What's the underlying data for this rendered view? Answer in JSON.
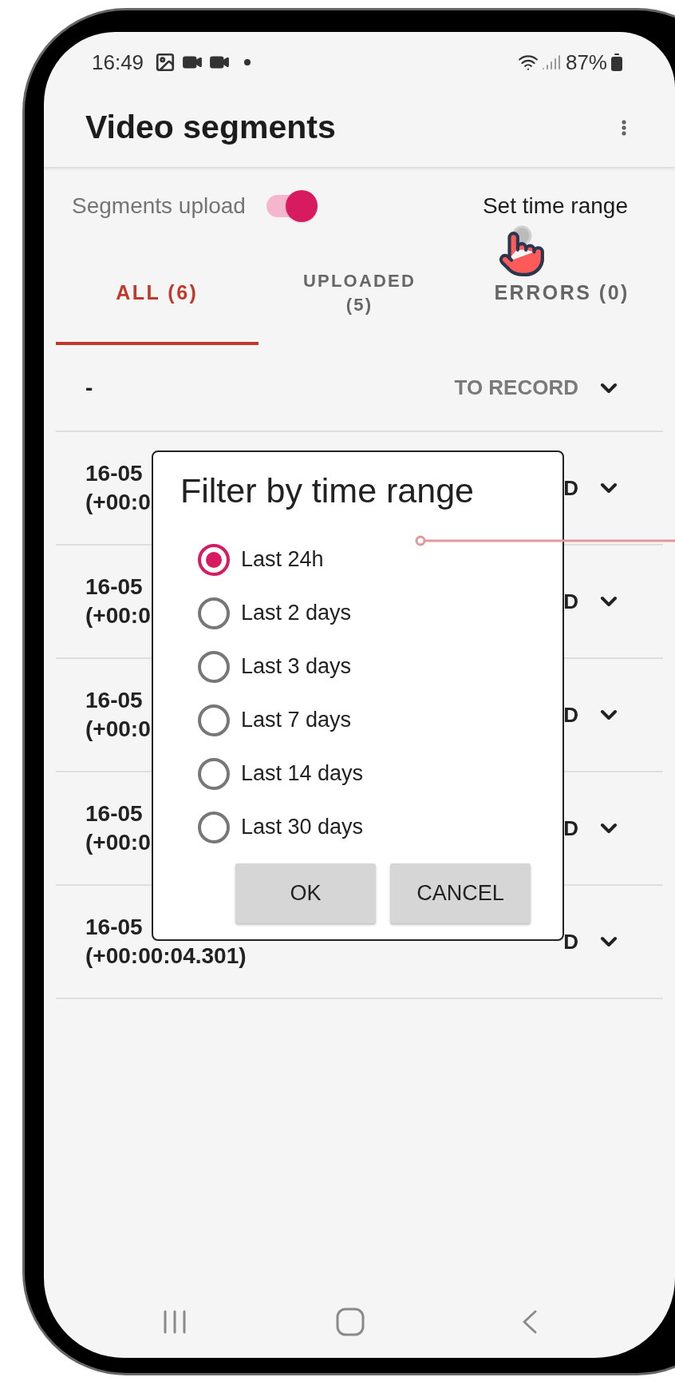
{
  "status_bar": {
    "time": "16:49",
    "battery": "87%"
  },
  "app_bar": {
    "title": "Video segments"
  },
  "controls": {
    "upload_label": "Segments upload",
    "upload_on": true,
    "time_range_link": "Set time range"
  },
  "tabs": [
    {
      "lines": [
        "ALL (6)"
      ],
      "selected": true
    },
    {
      "lines": [
        "UPLOADED",
        "(5)"
      ],
      "selected": false
    },
    {
      "lines": [
        "ERRORS (0)"
      ],
      "selected": false
    }
  ],
  "rows": [
    {
      "lines": [
        "-"
      ],
      "status": "TO RECORD",
      "kind": "pending"
    },
    {
      "lines": [
        "16-05",
        "(+00:0"
      ],
      "status": "D",
      "kind": "uploaded"
    },
    {
      "lines": [
        "16-05",
        "(+00:0"
      ],
      "status": "D",
      "kind": "uploaded"
    },
    {
      "lines": [
        "16-05",
        "(+00:0"
      ],
      "status": "D",
      "kind": "uploaded"
    },
    {
      "lines": [
        "16-05",
        "(+00:0"
      ],
      "status": "D",
      "kind": "uploaded"
    },
    {
      "lines": [
        "16-05",
        "(+00:00:04.301)"
      ],
      "status": "D",
      "kind": "uploaded"
    }
  ],
  "dialog": {
    "title": "Filter by time range",
    "options": [
      {
        "label": "Last 24h",
        "selected": true
      },
      {
        "label": "Last 2 days",
        "selected": false
      },
      {
        "label": "Last 3 days",
        "selected": false
      },
      {
        "label": "Last 7 days",
        "selected": false
      },
      {
        "label": "Last 14 days",
        "selected": false
      },
      {
        "label": "Last 30 days",
        "selected": false
      }
    ],
    "buttons": [
      "OK",
      "CANCEL"
    ]
  }
}
